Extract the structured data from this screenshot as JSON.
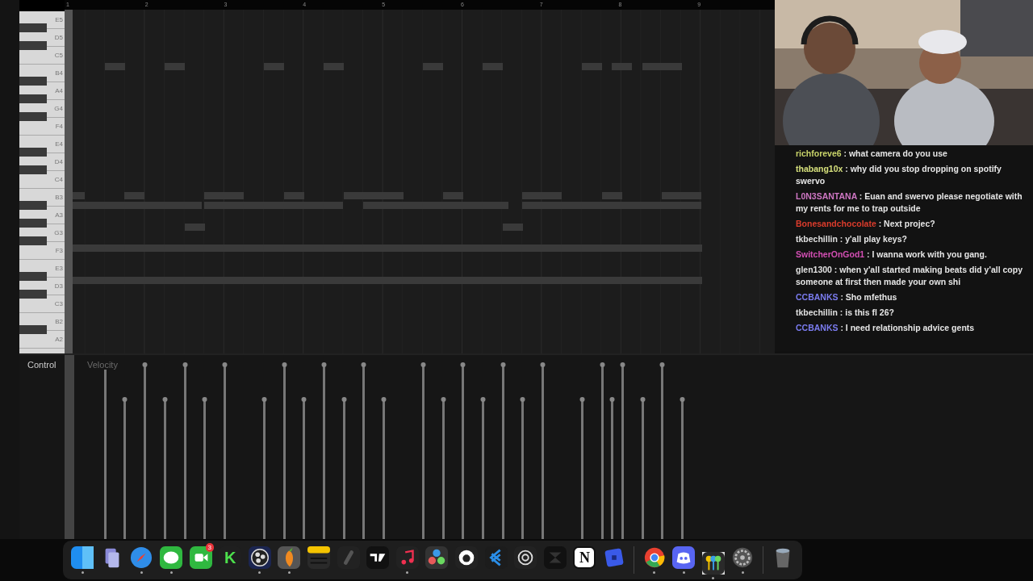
{
  "ruler": {
    "bars": [
      "1",
      "2",
      "3",
      "4",
      "5",
      "6",
      "7",
      "8",
      "9"
    ]
  },
  "piano_keys": [
    "E5",
    "D5",
    "C5",
    "B4",
    "A4",
    "G4",
    "F4",
    "E4",
    "D4",
    "C4",
    "B3",
    "A3",
    "G3",
    "F3",
    "E3",
    "D3",
    "C3",
    "B2",
    "A2"
  ],
  "control_panel": {
    "label": "Control",
    "parameter": "Velocity"
  },
  "chat": [
    {
      "user": "richforeve6",
      "color": "#c9d46a",
      "text": ": what camera do you use"
    },
    {
      "user": "thabang10x",
      "color": "#d6e07c",
      "text": ": why did you stop dropping on spotify swervo"
    },
    {
      "user": "L0N3SANTANA",
      "color": "#cf77c4",
      "text": ": Euan and swervo please negotiate with my rents for me to trap outside"
    },
    {
      "user": "Bonesandchocolate",
      "color": "#dc3c2c",
      "text": ": Next projec?"
    },
    {
      "user": "tkbechillin",
      "color": "#e0e0e0",
      "text": ": y'all play keys?"
    },
    {
      "user": "SwitcherOnGod1",
      "color": "#d44fb4",
      "text": ": I wanna work with you gang."
    },
    {
      "user": "glen1300",
      "color": "#e0e0e0",
      "text": ": when y'all started making beats did y'all copy someone at first then made your own shi"
    },
    {
      "user": "CCBANKS",
      "color": "#7b7cf0",
      "text": ": Sho mfethus"
    },
    {
      "user": "tkbechillin",
      "color": "#e0e0e0",
      "text": ": is this fl 26?"
    },
    {
      "user": "CCBANKS",
      "color": "#7b7cf0",
      "text": ": I need relationship advice gents"
    }
  ],
  "dock": [
    {
      "kind": "finder",
      "running": true
    },
    {
      "kind": "files",
      "running": false
    },
    {
      "kind": "safari",
      "running": true
    },
    {
      "kind": "messages",
      "running": true
    },
    {
      "kind": "facetime",
      "running": false,
      "badge": "3"
    },
    {
      "kind": "letter",
      "running": false,
      "glyph": "K"
    },
    {
      "kind": "obs",
      "running": true
    },
    {
      "kind": "fl",
      "running": true
    },
    {
      "kind": "notes",
      "running": false
    },
    {
      "kind": "slash",
      "running": false
    },
    {
      "kind": "tv",
      "running": false
    },
    {
      "kind": "music",
      "running": true
    },
    {
      "kind": "resolve",
      "running": false
    },
    {
      "kind": "github",
      "running": false
    },
    {
      "kind": "vscode",
      "running": false
    },
    {
      "kind": "knot",
      "running": false
    },
    {
      "kind": "capcut",
      "running": false
    },
    {
      "kind": "notion",
      "running": false,
      "glyph": "N"
    },
    {
      "kind": "square",
      "running": false
    },
    {
      "kind": "separator"
    },
    {
      "kind": "chrome",
      "running": true
    },
    {
      "kind": "discord",
      "running": true
    },
    {
      "kind": "keys",
      "running": true
    },
    {
      "kind": "settings",
      "running": true
    },
    {
      "kind": "separator"
    },
    {
      "kind": "trash",
      "running": false
    }
  ]
}
